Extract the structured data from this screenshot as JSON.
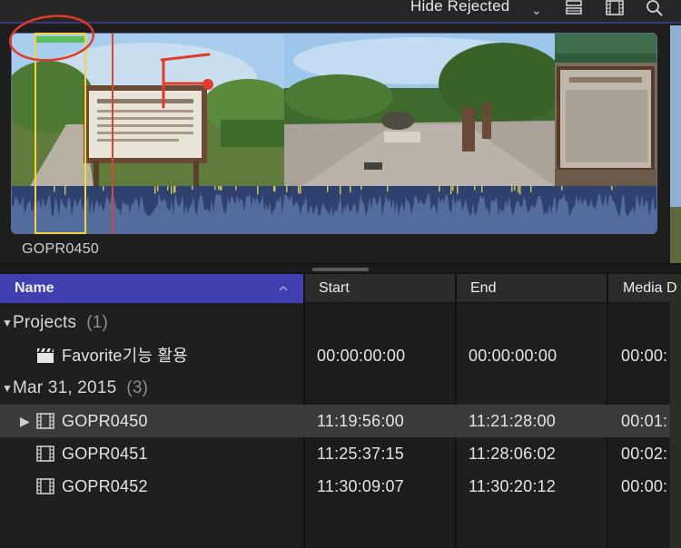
{
  "toolbar": {
    "hide_rejected_label": "Hide Rejected",
    "icons": [
      "updown-chevron-icon",
      "clip-appearance-icon",
      "filmstrip-icon",
      "search-icon"
    ]
  },
  "browser": {
    "clip_name": "GOPR0450",
    "colors": {
      "clip_bg": "#455b8b",
      "waveform": "#2f416e",
      "selection": "#f3d53a",
      "playhead": "#d9452f",
      "favorite": "#5cbd5c",
      "annotation": "#e23a2a"
    }
  },
  "list": {
    "columns": {
      "name": "Name",
      "start": "Start",
      "end": "End",
      "media": "Media D"
    },
    "groups": [
      {
        "label": "Projects",
        "count": "(1)"
      },
      {
        "label": "Mar 31, 2015",
        "count": "(3)"
      }
    ],
    "project": {
      "name": "Favorite기능 활용",
      "start": "00:00:00:00",
      "end": "00:00:00:00",
      "media": "00:00:"
    },
    "clips": [
      {
        "name": "GOPR0450",
        "start": "11:19:56:00",
        "end": "11:21:28:00",
        "media": "00:01:"
      },
      {
        "name": "GOPR0451",
        "start": "11:25:37:15",
        "end": "11:28:06:02",
        "media": "00:02:"
      },
      {
        "name": "GOPR0452",
        "start": "11:30:09:07",
        "end": "11:30:20:12",
        "media": "00:00:"
      }
    ],
    "colors": {
      "header_selected": "#3f3fb0",
      "row_selected": "#3a3a3c"
    }
  }
}
